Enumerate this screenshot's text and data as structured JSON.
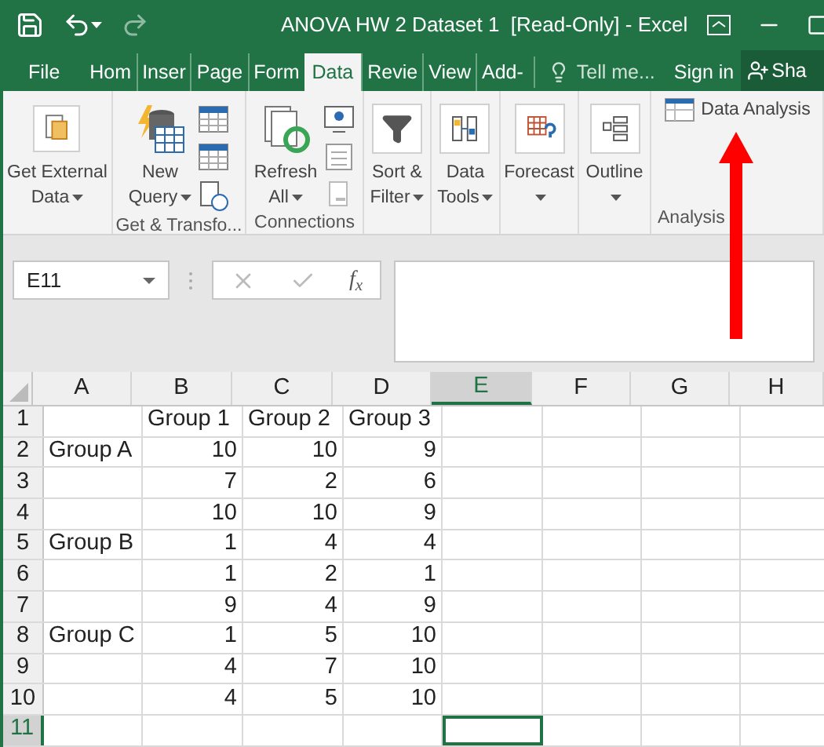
{
  "window": {
    "title": "ANOVA HW 2 Dataset 1  [Read-Only] - Excel"
  },
  "tabs": [
    {
      "label": "File",
      "selected": false
    },
    {
      "label": "Hom",
      "selected": false
    },
    {
      "label": "Inser",
      "selected": false
    },
    {
      "label": "Page",
      "selected": false
    },
    {
      "label": "Form",
      "selected": false
    },
    {
      "label": "Data",
      "selected": true
    },
    {
      "label": "Revie",
      "selected": false
    },
    {
      "label": "View",
      "selected": false
    },
    {
      "label": "Add-",
      "selected": false
    }
  ],
  "tell_me": {
    "placeholder": "Tell me..."
  },
  "sign_in": "Sign in",
  "share": "Sha",
  "ribbon": {
    "groups": [
      {
        "buttons": [
          {
            "kind": "large",
            "label": "Get External",
            "label2": "Data",
            "dropdown": true
          }
        ]
      },
      {
        "label": "Get & Transfo...",
        "buttons": [
          {
            "kind": "large",
            "label": "New",
            "label2": "Query",
            "dropdown": true
          },
          {
            "kind": "smallstack"
          }
        ]
      },
      {
        "label": "Connections",
        "buttons": [
          {
            "kind": "large",
            "label": "Refresh",
            "label2": "All",
            "dropdown": true
          },
          {
            "kind": "smallstack"
          }
        ]
      },
      {
        "buttons": [
          {
            "kind": "large",
            "label": "Sort &",
            "label2": "Filter",
            "dropdown": true
          }
        ]
      },
      {
        "buttons": [
          {
            "kind": "large",
            "label": "Data",
            "label2": "Tools",
            "dropdown": true
          }
        ]
      },
      {
        "buttons": [
          {
            "kind": "large",
            "label": "Forecast",
            "dropdown": true
          }
        ]
      },
      {
        "buttons": [
          {
            "kind": "large",
            "label": "Outline",
            "dropdown": true
          }
        ]
      },
      {
        "label": "Analysis",
        "buttons": [
          {
            "kind": "small",
            "label": "Data Analysis"
          }
        ]
      }
    ]
  },
  "formula_bar": {
    "name_box": "E11",
    "function_label": "f$_{x}$"
  },
  "grid": {
    "columns": [
      {
        "label": "A",
        "selected": false
      },
      {
        "label": "B",
        "selected": false
      },
      {
        "label": "C",
        "selected": false
      },
      {
        "label": "D",
        "selected": false
      },
      {
        "label": "E",
        "selected": true
      },
      {
        "label": "F",
        "selected": false
      },
      {
        "label": "G",
        "selected": false
      },
      {
        "label": "H",
        "selected": false
      }
    ],
    "rows": [
      {
        "number": "1",
        "selected": false,
        "kind": "header",
        "cells": [
          null,
          "Group 1",
          "Group 2",
          "Group 3",
          null,
          null,
          null,
          null
        ]
      },
      {
        "number": "2",
        "selected": false,
        "kind": "data",
        "cells": [
          "Group A",
          "10",
          "10",
          "9",
          null,
          null,
          null,
          null
        ]
      },
      {
        "number": "3",
        "selected": false,
        "kind": "data",
        "cells": [
          null,
          "7",
          "2",
          "6",
          null,
          null,
          null,
          null
        ]
      },
      {
        "number": "4",
        "selected": false,
        "kind": "data",
        "cells": [
          null,
          "10",
          "10",
          "9",
          null,
          null,
          null,
          null
        ]
      },
      {
        "number": "5",
        "selected": false,
        "kind": "data",
        "cells": [
          "Group B",
          "1",
          "4",
          "4",
          null,
          null,
          null,
          null
        ]
      },
      {
        "number": "6",
        "selected": false,
        "kind": "data",
        "cells": [
          null,
          "1",
          "2",
          "1",
          null,
          null,
          null,
          null
        ]
      },
      {
        "number": "7",
        "selected": false,
        "kind": "data",
        "cells": [
          null,
          "9",
          "4",
          "9",
          null,
          null,
          null,
          null
        ]
      },
      {
        "number": "8",
        "selected": false,
        "kind": "data",
        "cells": [
          "Group C",
          "1",
          "5",
          "10",
          null,
          null,
          null,
          null
        ]
      },
      {
        "number": "9",
        "selected": false,
        "kind": "data",
        "cells": [
          null,
          "4",
          "7",
          "10",
          null,
          null,
          null,
          null
        ]
      },
      {
        "number": "10",
        "selected": false,
        "kind": "data",
        "cells": [
          null,
          "4",
          "5",
          "10",
          null,
          null,
          null,
          null
        ]
      },
      {
        "number": "11",
        "selected": true,
        "kind": "data",
        "cells": [
          null,
          null,
          null,
          null,
          null,
          null,
          null,
          null
        ]
      }
    ]
  }
}
